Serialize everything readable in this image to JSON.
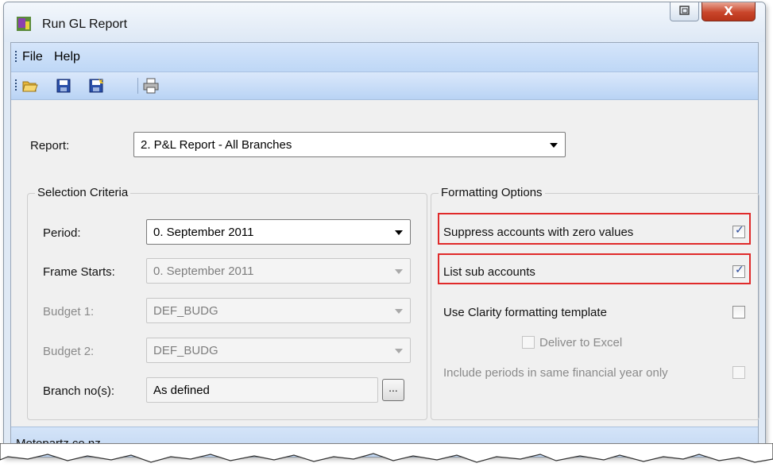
{
  "window": {
    "title": "Run GL Report",
    "close_glyph": "X"
  },
  "menu": {
    "items": [
      "File",
      "Help"
    ]
  },
  "toolbar": {
    "icons": [
      "open-folder-icon",
      "save-icon",
      "save-as-icon",
      "print-icon"
    ]
  },
  "report": {
    "label": "Report:",
    "value": "2. P&L Report - All Branches"
  },
  "selection": {
    "title": "Selection Criteria",
    "period_label": "Period:",
    "period_value": "0. September 2011",
    "frame_label": "Frame Starts:",
    "frame_value": "0. September 2011",
    "budget1_label": "Budget 1:",
    "budget1_value": "DEF_BUDG",
    "budget2_label": "Budget 2:",
    "budget2_value": "DEF_BUDG",
    "branch_label": "Branch no(s):",
    "branch_value": "As defined",
    "browse_label": "..."
  },
  "formatting": {
    "title": "Formatting Options",
    "suppress_label": "Suppress accounts with zero values",
    "suppress_checked": true,
    "list_sub_label": "List sub accounts",
    "list_sub_checked": true,
    "clarity_label": "Use Clarity formatting template",
    "clarity_checked": false,
    "deliver_label": "Deliver to Excel",
    "deliver_checked": false,
    "include_label": "Include periods in same financial year only",
    "include_checked": false
  },
  "status": {
    "text": "Motopartz.co.nz"
  },
  "colors": {
    "highlight": "#e02a2a",
    "close": "#c9452a",
    "menubar": "#c8ddf7"
  }
}
